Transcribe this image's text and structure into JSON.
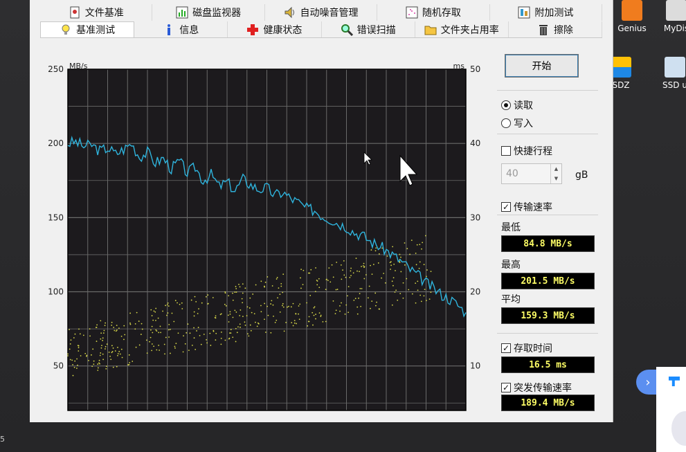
{
  "desktop": {
    "icons": [
      {
        "label": "Genius",
        "color": "#f07c1e"
      },
      {
        "label": "MyDis",
        "color": "#dcdcdc"
      },
      {
        "label": "SDZ",
        "color": "#1e88e5"
      },
      {
        "label": "SSD u",
        "color": "#cfe0f0"
      }
    ],
    "bottom_left_text": "5"
  },
  "app": {
    "tabs_back": [
      {
        "label": "文件基准",
        "icon": "document-benchmark-icon"
      },
      {
        "label": "磁盘监视器",
        "icon": "disk-monitor-icon"
      },
      {
        "label": "自动噪音管理",
        "icon": "speaker-icon"
      },
      {
        "label": "随机存取",
        "icon": "random-access-icon"
      },
      {
        "label": "附加测试",
        "icon": "extra-tests-icon"
      }
    ],
    "tabs_front": [
      {
        "label": "基准测试",
        "icon": "lightbulb-icon",
        "active": true
      },
      {
        "label": "信息",
        "icon": "info-icon"
      },
      {
        "label": "健康状态",
        "icon": "health-cross-icon"
      },
      {
        "label": "错误扫描",
        "icon": "magnifier-icon"
      },
      {
        "label": "文件夹占用率",
        "icon": "folder-icon"
      },
      {
        "label": "擦除",
        "icon": "trash-icon"
      }
    ]
  },
  "panel": {
    "start_button": "开始",
    "mode_read": "读取",
    "mode_write": "写入",
    "mode_selected": "read",
    "quick_stroke_label": "快捷行程",
    "quick_stroke_checked": false,
    "quick_stroke_value": "40",
    "quick_stroke_unit": "gB",
    "transfer_rate_label": "传输速率",
    "transfer_rate_checked": true,
    "min_label": "最低",
    "min_value": "84.8 MB/s",
    "max_label": "最高",
    "max_value": "201.5 MB/s",
    "avg_label": "平均",
    "avg_value": "159.3 MB/s",
    "access_time_label": "存取时间",
    "access_time_checked": true,
    "access_time_value": "16.5 ms",
    "burst_label": "突发传输速率",
    "burst_checked": true,
    "burst_value": "189.4 MB/s"
  },
  "chart_data": {
    "type": "line",
    "left_unit": "MB/s",
    "right_unit": "ms",
    "left_ticks": [
      250,
      200,
      150,
      100,
      50
    ],
    "right_ticks": [
      50,
      40,
      30,
      20,
      10
    ],
    "ylim_left": [
      20,
      250
    ],
    "ylim_right": [
      4,
      50
    ],
    "xlim": [
      0,
      100
    ],
    "grid": true,
    "background": "#1c1a1d",
    "grid_color": "#6a6a6a",
    "series": [
      {
        "kind": "line",
        "color": "#2fb4dd",
        "x": [
          0,
          2,
          4,
          6,
          8,
          10,
          12,
          14,
          16,
          18,
          20,
          22,
          24,
          26,
          28,
          30,
          32,
          34,
          36,
          38,
          40,
          42,
          44,
          46,
          48,
          50,
          52,
          54,
          56,
          58,
          60,
          62,
          64,
          66,
          68,
          70,
          72,
          74,
          76,
          78,
          80,
          82,
          84,
          86,
          88,
          90,
          92,
          94,
          96,
          98,
          100
        ],
        "y": [
          200,
          201,
          198,
          199,
          195,
          197,
          193,
          196,
          200,
          191,
          194,
          187,
          190,
          183,
          188,
          180,
          184,
          175,
          179,
          171,
          174,
          168,
          176,
          172,
          169,
          170,
          165,
          167,
          163,
          160,
          156,
          155,
          151,
          149,
          146,
          144,
          140,
          138,
          134,
          131,
          128,
          124,
          120,
          115,
          111,
          106,
          102,
          98,
          95,
          91,
          86
        ]
      },
      {
        "kind": "scatter",
        "color": "#d8d84a",
        "x_range": [
          0,
          92
        ],
        "y_band_start": [
          42,
          75
        ],
        "y_band_end": [
          95,
          140
        ]
      }
    ]
  }
}
